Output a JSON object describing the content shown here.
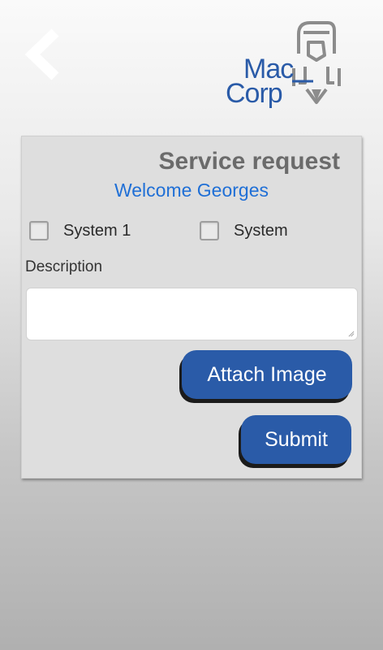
{
  "header": {
    "back_icon": "chevron-left-icon",
    "logo": {
      "line1": "Mac",
      "line2": "Corp",
      "colors": {
        "text": "#2a5ba8",
        "emblem": "#8c8c8c"
      }
    }
  },
  "form": {
    "title": "Service request",
    "welcome": "Welcome Georges",
    "checkboxes": [
      {
        "label": "System 1",
        "checked": false
      },
      {
        "label": "System",
        "checked": false
      }
    ],
    "description_label": "Description",
    "description_value": "",
    "attach_label": "Attach Image",
    "submit_label": "Submit"
  },
  "colors": {
    "title": "#6b6b6b",
    "welcome": "#1f6fd6",
    "button": "#2a5ba8",
    "card": "#dedede"
  }
}
